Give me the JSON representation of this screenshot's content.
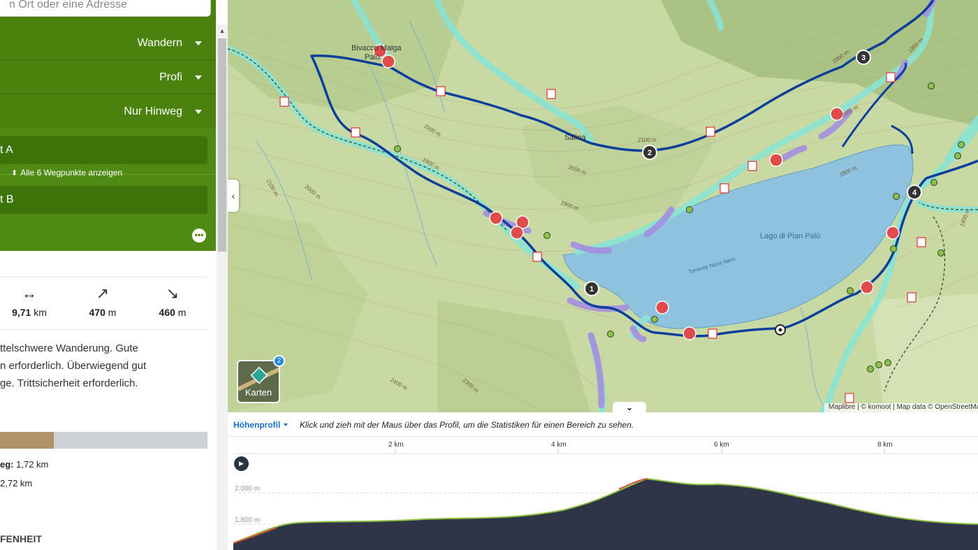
{
  "search": {
    "placeholder": "n Ort oder eine Adresse"
  },
  "dropdowns": {
    "sport": "Wandern",
    "level": "Profi",
    "direction": "Nur Hinweg"
  },
  "waypoints": {
    "start": "t A",
    "end": "t B",
    "show_all": "Alle 6 Wegpunkte anzeigen"
  },
  "stats": {
    "distance": {
      "value": "9,71",
      "unit": "km"
    },
    "ascent": {
      "value": "470",
      "unit": "m"
    },
    "descent": {
      "value": "460",
      "unit": "m"
    }
  },
  "description": {
    "line1": "ttelschwere Wanderung. Gute",
    "line2": "n erforderlich. Überwiegend gut",
    "line3": "ge. Trittsicherheit erforderlich."
  },
  "surface": {
    "row1_label": "eg:",
    "row1_value": "1,72 km",
    "row2_value": "2,72 km",
    "bar_fraction": 0.26,
    "bar_color": "#b09367",
    "track_color": "#cdd1d6",
    "section_title": "FENHEIT"
  },
  "map": {
    "labels": {
      "lake": "Lago di Pian Palù",
      "stream": "Torrente Noce Nero",
      "place1": "Bivacco Malga",
      "place2": "Palù",
      "place3": "Salina",
      "c2000a": "2000 m",
      "c1900a": "1900 m",
      "c2100a": "2100 m",
      "c2000b": "2000 m",
      "c1900b": "1900 m",
      "c2000c": "2000 m",
      "c2100b": "2100 m",
      "c1800": "1800 m",
      "c2400": "2400 m",
      "c2300": "2300 m",
      "c2000d": "2000 m",
      "c1900c": "1900 m",
      "c1900d": "1900 m",
      "c2000e": "2000 m"
    },
    "markers": [
      "1",
      "2",
      "3",
      "4"
    ],
    "karten_label": "Karten",
    "karten_badge": "2",
    "attribution": "Maplibre | © komoot | Map data © OpenStreetMap",
    "route_color": "#0b3f9c",
    "lake_color": "#8fc3dd"
  },
  "profile": {
    "label": "Höhenprofil",
    "hint": "Klick und zieh mit der Maus über das Profil, um die Statistiken für einen Bereich zu sehen.",
    "x_ticks": [
      "2 km",
      "4 km",
      "6 km",
      "8 km"
    ],
    "y_ticks": [
      "2.000 m",
      "1.800 m"
    ]
  }
}
